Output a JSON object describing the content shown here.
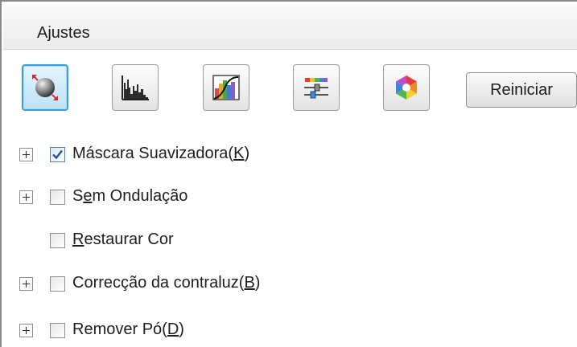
{
  "panel": {
    "title": "Ajustes"
  },
  "toolbar": {
    "buttons": [
      {
        "name": "auto-exposure-icon",
        "active": true
      },
      {
        "name": "histogram-icon",
        "active": false
      },
      {
        "name": "tone-curve-icon",
        "active": false
      },
      {
        "name": "image-adjustment-sliders-icon",
        "active": false
      },
      {
        "name": "color-palette-icon",
        "active": false
      }
    ],
    "reset_label": "Reiniciar"
  },
  "options": [
    {
      "expandable": true,
      "checked": true,
      "pre": "Máscara Suavizadora(",
      "u": "K",
      "post": ")"
    },
    {
      "expandable": true,
      "checked": false,
      "pre": "S",
      "u": "e",
      "post": "m Ondulação"
    },
    {
      "expandable": false,
      "checked": false,
      "pre": "",
      "u": "R",
      "post": "estaurar Cor"
    },
    {
      "expandable": true,
      "checked": false,
      "pre": "Correcção da contraluz(",
      "u": "B",
      "post": ")"
    },
    {
      "expandable": true,
      "checked": false,
      "pre": "Remover Pó(",
      "u": "D",
      "post": ")"
    }
  ],
  "colors": {
    "active_border": "#3c9ed6",
    "active_fill": "#bfe2f7",
    "checkmark": "#2b4fa0"
  }
}
